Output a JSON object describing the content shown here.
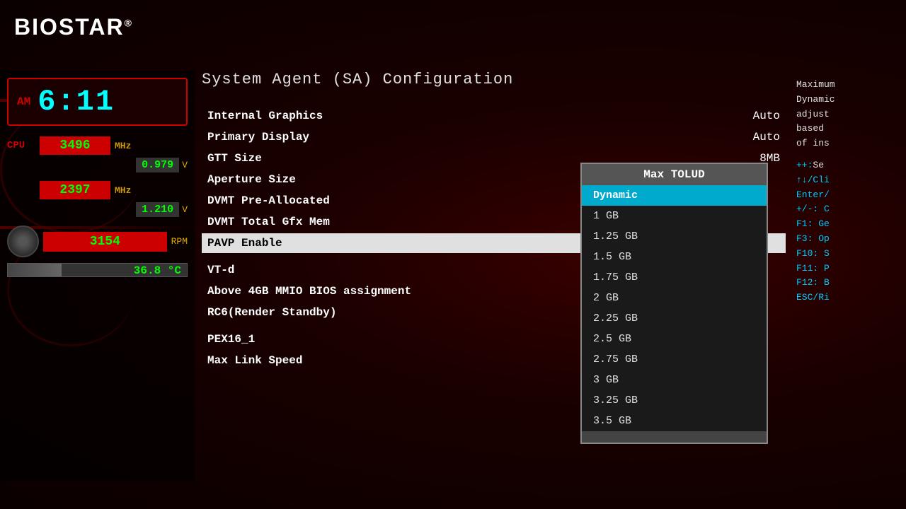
{
  "logo": {
    "text": "BIOSTAR",
    "registered": "®"
  },
  "clock": {
    "ampm": "AM",
    "time": "6:11"
  },
  "stats": {
    "cpu": {
      "label": "CPU",
      "freq_value": "3496",
      "freq_unit": "MHz",
      "voltage_value": "0.979",
      "voltage_unit": "V"
    },
    "mem": {
      "freq_value": "2397",
      "freq_unit": "MHz",
      "voltage_value": "1.210",
      "voltage_unit": "V"
    },
    "fan": {
      "rpm_value": "3154",
      "rpm_unit": "RPM"
    },
    "temp": {
      "value": "36.8",
      "unit": "°C"
    }
  },
  "page_title": "System Agent (SA) Configuration",
  "menu_items": [
    {
      "label": "Internal Graphics",
      "value": "Auto",
      "selected": false
    },
    {
      "label": "Primary Display",
      "value": "Auto",
      "selected": false
    },
    {
      "label": "GTT Size",
      "value": "8MB",
      "selected": false
    },
    {
      "label": "Aperture Size",
      "value": "",
      "selected": false
    },
    {
      "label": "DVMT Pre-Allocated",
      "value": "",
      "selected": false
    },
    {
      "label": "DVMT Total Gfx Mem",
      "value": "",
      "selected": false
    },
    {
      "label": "PAVP Enable",
      "value": "",
      "selected": true
    },
    {
      "label": "VT-d",
      "value": "",
      "selected": false
    },
    {
      "label": "Above 4GB MMIO BIOS assignment",
      "value": "",
      "selected": false
    },
    {
      "label": "RC6(Render Standby)",
      "value": "",
      "selected": false
    },
    {
      "label": "PEX16_1",
      "value": "",
      "selected": false
    },
    {
      "label": "  Max Link Speed",
      "value": "",
      "selected": false
    }
  ],
  "dropdown": {
    "title": "Max TOLUD",
    "options": [
      {
        "label": "Dynamic",
        "active": true
      },
      {
        "label": "1 GB",
        "active": false
      },
      {
        "label": "1.25 GB",
        "active": false
      },
      {
        "label": "1.5 GB",
        "active": false
      },
      {
        "label": "1.75 GB",
        "active": false
      },
      {
        "label": "2 GB",
        "active": false
      },
      {
        "label": "2.25 GB",
        "active": false
      },
      {
        "label": "2.5 GB",
        "active": false
      },
      {
        "label": "2.75 GB",
        "active": false
      },
      {
        "label": "3 GB",
        "active": false
      },
      {
        "label": "3.25 GB",
        "active": false
      },
      {
        "label": "3.5 GB",
        "active": false
      }
    ]
  },
  "help": {
    "description_lines": [
      "Maximum",
      "Dynamic",
      "adjust",
      "based",
      "of ins"
    ],
    "keys": [
      {
        "key": "++:",
        "desc": "Se"
      },
      {
        "key": "↑↓/Cli",
        "desc": ""
      },
      {
        "key": "Enter/",
        "desc": ""
      },
      {
        "key": "+/-: C",
        "desc": ""
      },
      {
        "key": "F1: Ge",
        "desc": ""
      },
      {
        "key": "F3: Op",
        "desc": ""
      },
      {
        "key": "F10: S",
        "desc": ""
      },
      {
        "key": "F11: P",
        "desc": ""
      },
      {
        "key": "F12: B",
        "desc": ""
      },
      {
        "key": "ESC/Ri",
        "desc": ""
      }
    ]
  }
}
